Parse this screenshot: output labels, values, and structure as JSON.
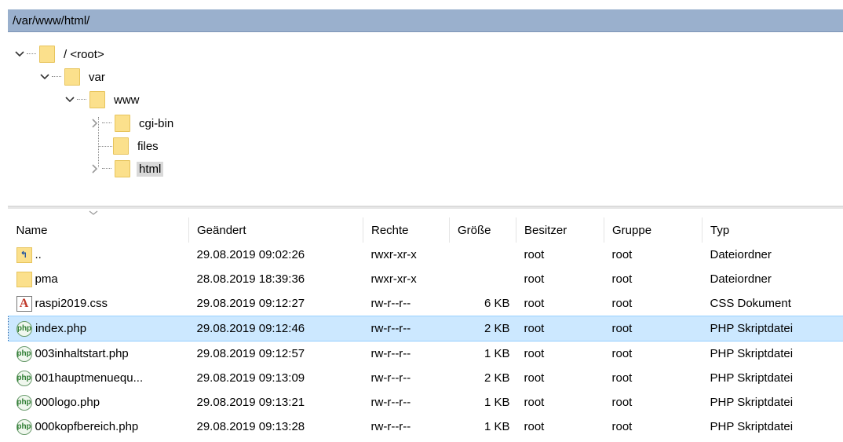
{
  "path_bar": {
    "text": "/var/www/html/"
  },
  "tree": {
    "root": "/ <root>",
    "var": "var",
    "www": "www",
    "cgi_bin": "cgi-bin",
    "files": "files",
    "html": "html"
  },
  "columns": [
    "Name",
    "Geändert",
    "Rechte",
    "Größe",
    "Besitzer",
    "Gruppe",
    "Typ"
  ],
  "rows": [
    {
      "icon": "parent-folder-icon",
      "name": "..",
      "modified": "29.08.2019 09:02:26",
      "perms": "rwxr-xr-x",
      "size": "",
      "owner": "root",
      "group": "root",
      "type": "Dateiordner"
    },
    {
      "icon": "folder-icon",
      "name": "pma",
      "modified": "28.08.2019 18:39:36",
      "perms": "rwxr-xr-x",
      "size": "",
      "owner": "root",
      "group": "root",
      "type": "Dateiordner"
    },
    {
      "icon": "css-file-icon",
      "name": "raspi2019.css",
      "modified": "29.08.2019 09:12:27",
      "perms": "rw-r--r--",
      "size": "6 KB",
      "owner": "root",
      "group": "root",
      "type": "CSS Dokument"
    },
    {
      "icon": "php-file-icon",
      "name": "index.php",
      "modified": "29.08.2019 09:12:46",
      "perms": "rw-r--r--",
      "size": "2 KB",
      "owner": "root",
      "group": "root",
      "type": "PHP Skriptdatei"
    },
    {
      "icon": "php-file-icon",
      "name": "003inhaltstart.php",
      "modified": "29.08.2019 09:12:57",
      "perms": "rw-r--r--",
      "size": "1 KB",
      "owner": "root",
      "group": "root",
      "type": "PHP Skriptdatei"
    },
    {
      "icon": "php-file-icon",
      "name": "001hauptmenuequ...",
      "modified": "29.08.2019 09:13:09",
      "perms": "rw-r--r--",
      "size": "2 KB",
      "owner": "root",
      "group": "root",
      "type": "PHP Skriptdatei"
    },
    {
      "icon": "php-file-icon",
      "name": "000logo.php",
      "modified": "29.08.2019 09:13:21",
      "perms": "rw-r--r--",
      "size": "1 KB",
      "owner": "root",
      "group": "root",
      "type": "PHP Skriptdatei"
    },
    {
      "icon": "php-file-icon",
      "name": "000kopfbereich.php",
      "modified": "29.08.2019 09:13:28",
      "perms": "rw-r--r--",
      "size": "1 KB",
      "owner": "root",
      "group": "root",
      "type": "PHP Skriptdatei"
    }
  ],
  "colors": {
    "path_bar_bg": "#9ab0cd",
    "selected_row_bg": "#cce8ff",
    "folder": "#fbe08c"
  }
}
